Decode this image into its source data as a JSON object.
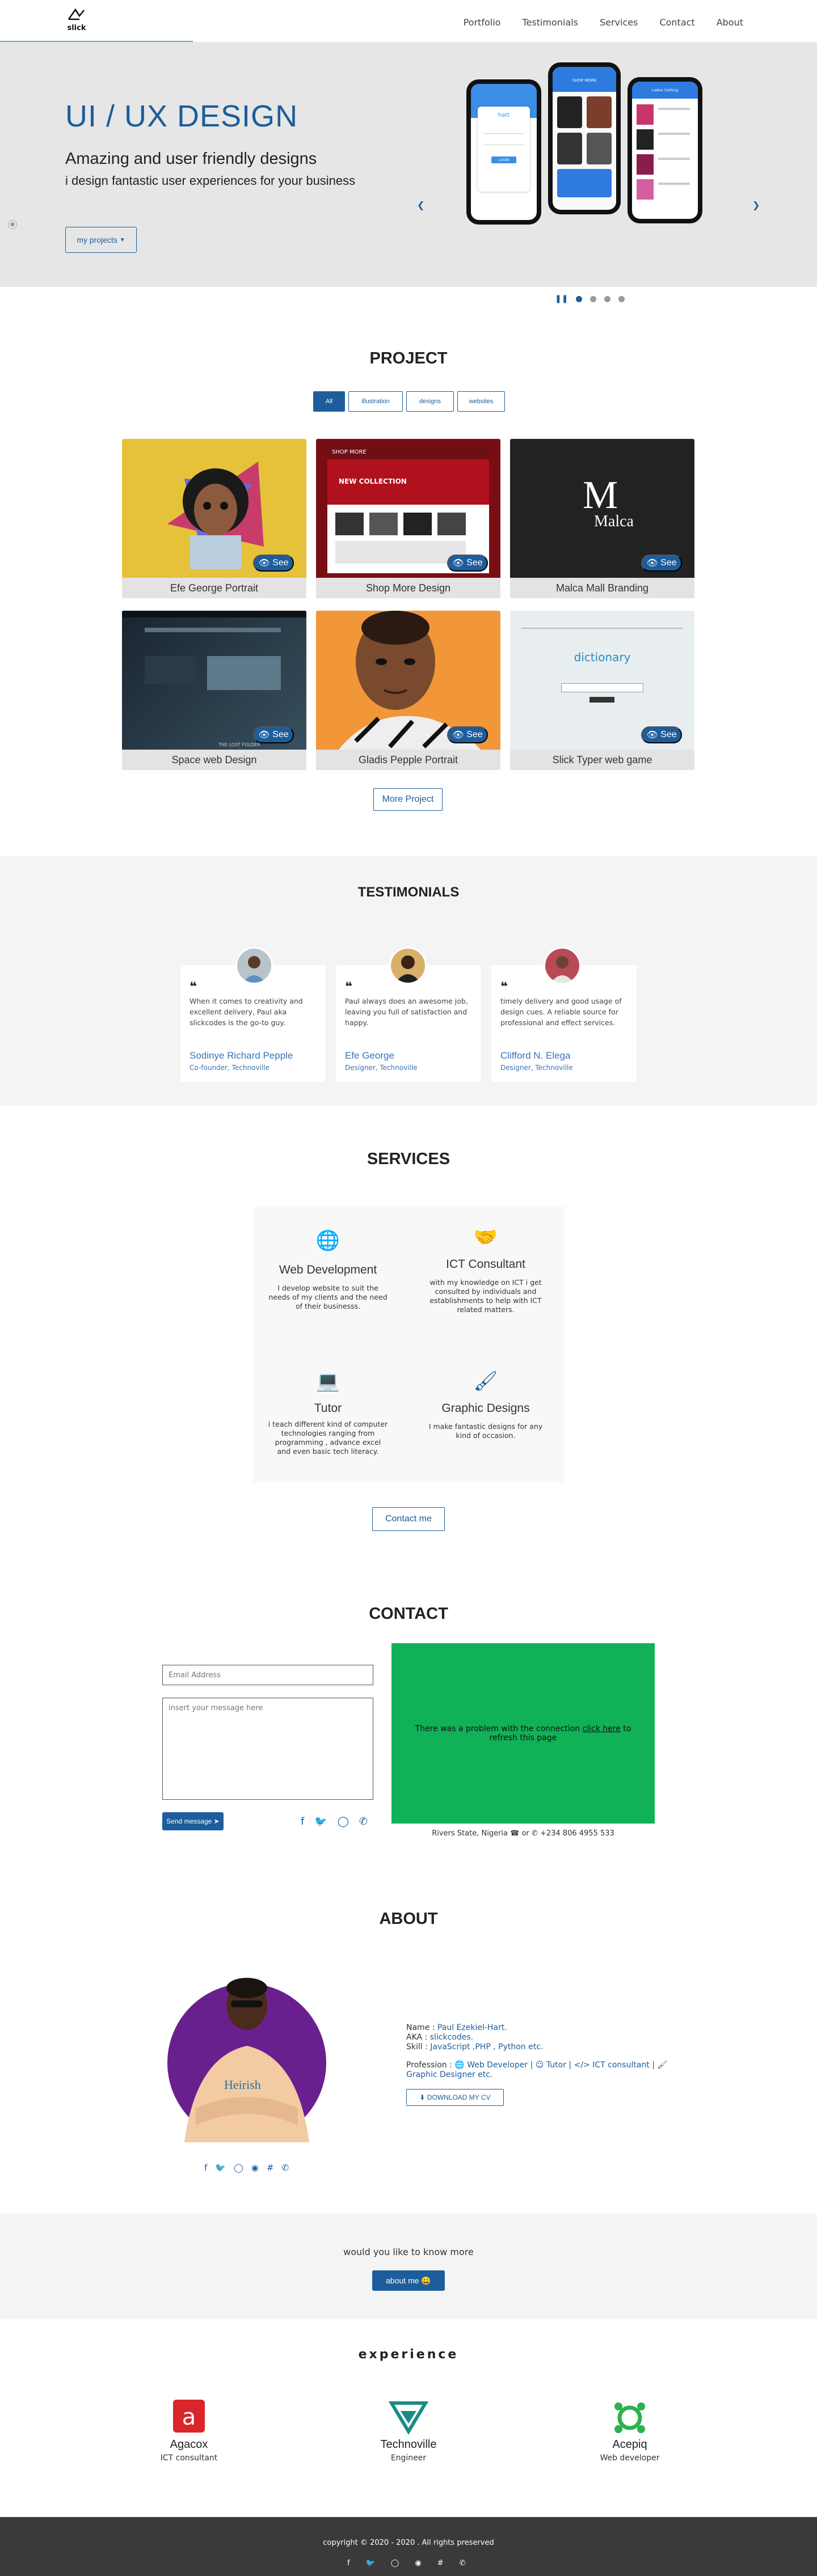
{
  "nav": {
    "logo_text": "slick",
    "items": [
      "Portfolio",
      "Testimonials",
      "Services",
      "Contact",
      "About"
    ]
  },
  "hero": {
    "title": "UI / UX DESIGN",
    "subtitle": "Amazing and user friendly designs",
    "tagline": "i design fantastic user experiences for your business",
    "button": "my projects",
    "prev_icon": "chevron-left-icon",
    "next_icon": "chevron-right-icon",
    "carousel_pause": "pause-icon",
    "carousel_dots": 4,
    "screens": {
      "login_logo": "hatt",
      "login_button": "LOGIN",
      "shop_label": "SHOP MORE",
      "catalog_label": "Ladies Clothing"
    }
  },
  "project": {
    "title": "PROJECT",
    "filters": [
      "All",
      "illustration",
      "designs",
      "websites"
    ],
    "cards": [
      {
        "caption": "Efe George Portrait",
        "see": "See",
        "bg": "#e6c23a"
      },
      {
        "caption": "Shop More Design",
        "see": "See",
        "bg": "#7a0d14"
      },
      {
        "caption": "Malca Mall Branding",
        "see": "See",
        "bg": "#222222"
      },
      {
        "caption": "Space web Design",
        "see": "See",
        "bg": "#243140"
      },
      {
        "caption": "Gladis Pepple Portrait",
        "see": "See",
        "bg": "#f2963a"
      },
      {
        "caption": "Slick Typer web game",
        "see": "See",
        "bg": "#e8eef0"
      }
    ],
    "card_texts": {
      "shop_logo": "SHOP MORE",
      "shop_banner": "NEW COLLECTION",
      "malca_m": "M",
      "malca_name": "Malca",
      "space_heading": "THE LOST FOLDER",
      "typer_word": "dictionary"
    },
    "more_button": "More Project"
  },
  "testimonials": {
    "title": "TESTIMONIALS",
    "items": [
      {
        "text": "When it comes to creativity and excellent delivery, Paul aka slickcodes is the go-to guy.",
        "name": "Sodinye Richard Pepple",
        "role": "Co-founder, Technoville"
      },
      {
        "text": "Paul always does an awesome job, leaving you full of satisfaction and happy.",
        "name": "Efe George",
        "role": "Designer, Technoville"
      },
      {
        "text": "timely delivery and good usage of design cues. A reliable source for professional and effect services.",
        "name": "Clifford N. Elega",
        "role": "Designer, Technoville"
      }
    ]
  },
  "services": {
    "title": "SERVICES",
    "items": [
      {
        "icon": "globe-icon",
        "title": "Web Development",
        "text": "I develop website to suit the needs of my clients and the need of their businesss."
      },
      {
        "icon": "handshake-icon",
        "title": "ICT Consultant",
        "text": "with my knowledge on ICT i get consulted by individuals and establishments to help with ICT related matters."
      },
      {
        "icon": "laptop-icon",
        "title": "Tutor",
        "text": "i teach different kind of computer technologies ranging from programming , advance excel and even basic tech literacy."
      },
      {
        "icon": "paint-brush-icon",
        "title": "Graphic Designs",
        "text": "I make fantastic designs for any kind of occasion."
      }
    ],
    "button": "Contact me"
  },
  "contact": {
    "title": "CONTACT",
    "email_placeholder": "Email Address",
    "message_placeholder": "insert your message here",
    "send_button": "Send message",
    "map_message": "There was a problem with the connection",
    "map_link": "click here",
    "map_suffix": "to refresh this page",
    "location": "Rivers State, Nigeria",
    "phone": "or",
    "phone_number": "+234 806 4955 533",
    "social_icons": [
      "facebook-icon",
      "twitter-icon",
      "instagram-icon",
      "whatsapp-icon"
    ]
  },
  "about": {
    "title": "ABOUT",
    "shirt_text": "Heirish",
    "name_label": "Name : ",
    "name_value": "Paul Ezekiel-Hart.",
    "aka_label": "AKA : ",
    "aka_value": "slickcodes.",
    "skill_label": "Skill : ",
    "skill_value": "JavaScript ,PHP , Python etc.",
    "profession_label": "Profession : ",
    "professions": [
      "Web Developer",
      "Tutor",
      "ICT consultant",
      "Graphic Designer etc."
    ],
    "cv_button": "DOWNLOAD MY CV",
    "social_icons": [
      "facebook-icon",
      "twitter-icon",
      "instagram-icon",
      "github-icon",
      "slack-icon",
      "whatsapp-icon"
    ]
  },
  "know_more": {
    "question": "would you like to know more",
    "button": "about me 😀"
  },
  "experience": {
    "title": "experience",
    "items": [
      {
        "name": "Agacox",
        "role": "ICT consultant",
        "color": "#d8262b"
      },
      {
        "name": "Technoville",
        "role": "Engineer",
        "color": "#1a8a84"
      },
      {
        "name": "Acepiq",
        "role": "Web developer",
        "color": "#2bb24c"
      }
    ]
  },
  "footer": {
    "copyright": "copyright © 2020 - 2020 . All rights preserved",
    "social_icons": [
      "facebook-icon",
      "twitter-icon",
      "instagram-icon",
      "github-icon",
      "slack-icon",
      "whatsapp-icon"
    ]
  },
  "colors": {
    "accent": "#1d5d9b",
    "map": "#10b157",
    "footer": "#3a3a3a"
  }
}
